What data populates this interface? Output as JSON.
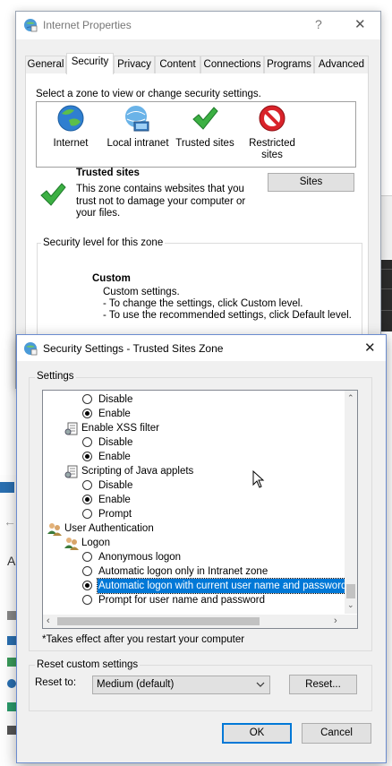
{
  "parent_dialog": {
    "title": "Internet Properties",
    "help_button": "?",
    "close_button": "✕",
    "tabs": [
      "General",
      "Security",
      "Privacy",
      "Content",
      "Connections",
      "Programs",
      "Advanced"
    ],
    "selected_tab": "Security",
    "zone_prompt": "Select a zone to view or change security settings.",
    "zones": [
      {
        "label": "Internet"
      },
      {
        "label": "Local intranet"
      },
      {
        "label": "Trusted sites"
      },
      {
        "label_line1": "Restricted",
        "label_line2": "sites"
      }
    ],
    "zone_title": "Trusted sites",
    "zone_desc_lines": [
      "This zone contains websites that you",
      "trust not to damage your computer or",
      "your files."
    ],
    "sites_button": "Sites",
    "security_level_group": "Security level for this zone",
    "level_name": "Custom",
    "level_lines": [
      "Custom settings.",
      "- To change the settings, click Custom level.",
      "- To use the recommended settings, click Default level."
    ]
  },
  "child_dialog": {
    "title": "Security Settings - Trusted Sites Zone",
    "close_button": "✕",
    "settings_group": "Settings",
    "rows": [
      {
        "kind": "radio",
        "label": "Disable",
        "checked": false
      },
      {
        "kind": "radio",
        "label": "Enable",
        "checked": true
      },
      {
        "kind": "setting",
        "label": "Enable XSS filter"
      },
      {
        "kind": "radio",
        "label": "Disable",
        "checked": false
      },
      {
        "kind": "radio",
        "label": "Enable",
        "checked": true
      },
      {
        "kind": "setting",
        "label": "Scripting of Java applets"
      },
      {
        "kind": "radio",
        "label": "Disable",
        "checked": false
      },
      {
        "kind": "radio",
        "label": "Enable",
        "checked": true
      },
      {
        "kind": "radio",
        "label": "Prompt",
        "checked": false
      },
      {
        "kind": "category",
        "label": "User Authentication"
      },
      {
        "kind": "subcategory",
        "label": "Logon"
      },
      {
        "kind": "radio2",
        "label": "Anonymous logon",
        "checked": false
      },
      {
        "kind": "radio2",
        "label": "Automatic logon only in Intranet zone",
        "checked": false
      },
      {
        "kind": "radio2",
        "label": "Automatic logon with current user name and password",
        "checked": true,
        "selected": true
      },
      {
        "kind": "radio2",
        "label": "Prompt for user name and password",
        "checked": false
      }
    ],
    "note": "*Takes effect after you restart your computer",
    "reset_group": "Reset custom settings",
    "reset_to_label": "Reset to:",
    "reset_value": "Medium (default)",
    "reset_button": "Reset...",
    "ok_button": "OK",
    "cancel_button": "Cancel"
  },
  "colors": {
    "selection": "#0078d7",
    "button_face": "#e1e1e1",
    "dialog_face": "#f0f0f0",
    "check_green": "#3cb043",
    "restricted_red": "#d9232a"
  }
}
